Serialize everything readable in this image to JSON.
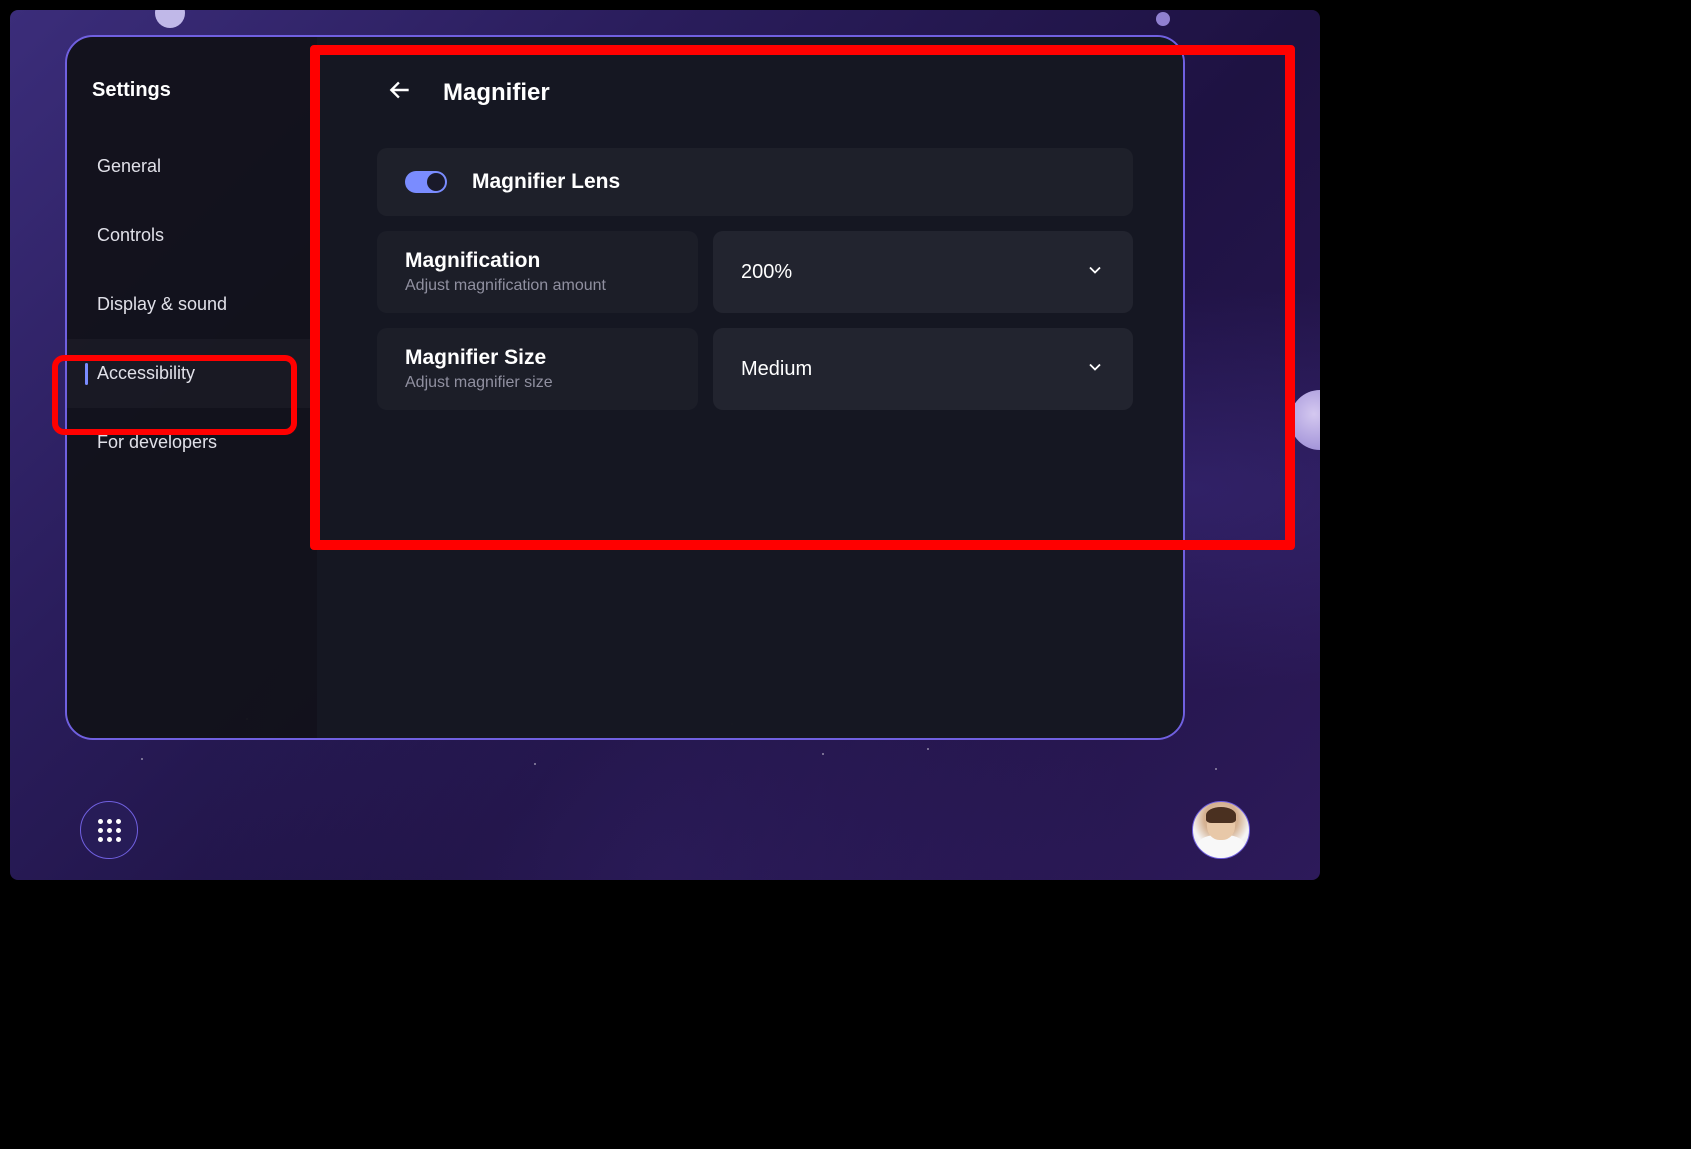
{
  "window": {
    "title": "Settings"
  },
  "sidebar": {
    "items": [
      {
        "label": "General",
        "active": false
      },
      {
        "label": "Controls",
        "active": false
      },
      {
        "label": "Display & sound",
        "active": false
      },
      {
        "label": "Accessibility",
        "active": true
      },
      {
        "label": "For developers",
        "active": false
      }
    ]
  },
  "panel": {
    "title": "Magnifier",
    "toggle": {
      "label": "Magnifier Lens",
      "enabled": true
    },
    "settings": [
      {
        "label": "Magnification",
        "description": "Adjust magnification amount",
        "value": "200%"
      },
      {
        "label": "Magnifier Size",
        "description": "Adjust magnifier size",
        "value": "Medium"
      }
    ]
  },
  "highlights": {
    "sidebar_item": "Accessibility",
    "main_panel": true
  },
  "colors": {
    "accent": "#7a8cff",
    "border": "#7060e0",
    "highlight": "#ff0000"
  }
}
